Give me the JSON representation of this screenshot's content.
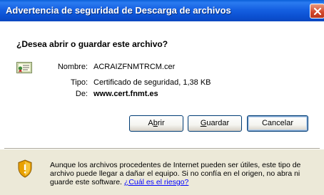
{
  "window": {
    "title": "Advertencia de seguridad de Descarga de archivos"
  },
  "question": "¿Desea abrir o guardar este archivo?",
  "file": {
    "name_label": "Nombre:",
    "name_value": "ACRAIZFNMTRCM.cer",
    "type_label": "Tipo:",
    "type_value": "Certificado de seguridad, 1,38 KB",
    "from_label": "De:",
    "from_value": "www.cert.fnmt.es",
    "icon": "certificate-icon"
  },
  "buttons": {
    "open": "Abrir",
    "save": "Guardar",
    "cancel": "Cancelar"
  },
  "warning": {
    "icon": "shield-warning-icon",
    "text": "Aunque los archivos procedentes de Internet pueden ser útiles, este tipo de archivo puede llegar a dañar el equipo. Si no confía en el origen, no abra ni guarde este software. ",
    "link": "¿Cuál es el riesgo?"
  },
  "colors": {
    "titlebar": "#0A5FD8",
    "dialog_bg": "#ECE9D8",
    "close": "#D2452A",
    "link": "#0000FF"
  }
}
